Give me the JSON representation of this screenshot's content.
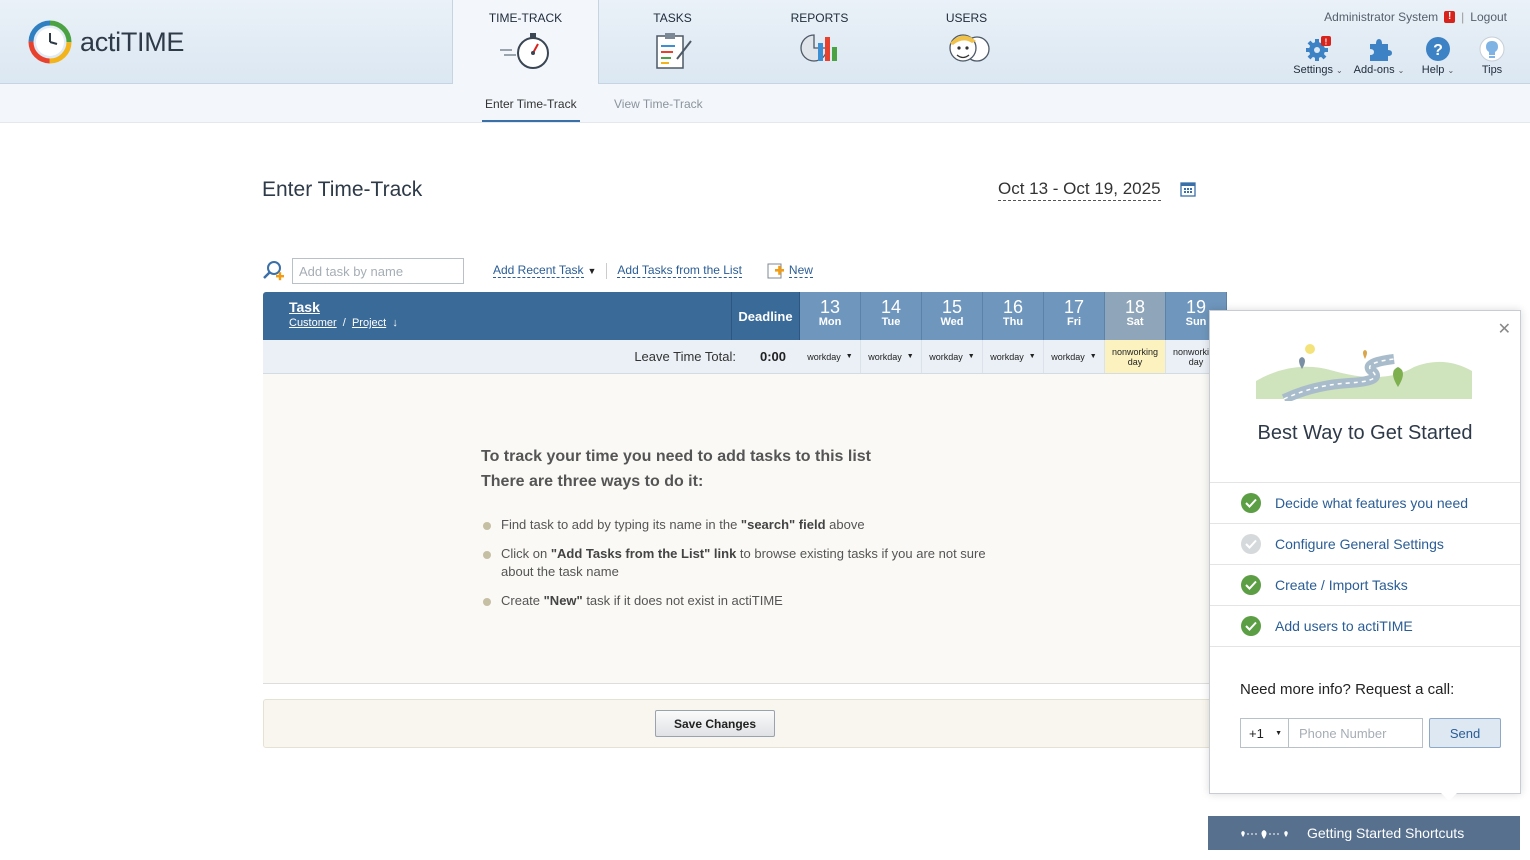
{
  "app": {
    "name": "actiTIME"
  },
  "nav": {
    "items": [
      {
        "label": "TIME-TRACK",
        "icon": "stopwatch-icon"
      },
      {
        "label": "TASKS",
        "icon": "clipboard-icon"
      },
      {
        "label": "REPORTS",
        "icon": "report-chart-icon"
      },
      {
        "label": "USERS",
        "icon": "users-icon"
      }
    ]
  },
  "user": {
    "name": "Administrator System",
    "logout": "Logout"
  },
  "tools": {
    "settings": "Settings",
    "addons": "Add-ons",
    "help": "Help",
    "tips": "Tips"
  },
  "subnav": {
    "enter": "Enter Time-Track",
    "view": "View Time-Track"
  },
  "page": {
    "title": "Enter Time-Track",
    "date_range": "Oct 13 - Oct 19, 2025"
  },
  "toolbar": {
    "search_placeholder": "Add task by name",
    "add_recent": "Add Recent Task",
    "add_from_list": "Add Tasks from the List",
    "new": "New"
  },
  "grid": {
    "task_header": "Task",
    "customer": "Customer",
    "project": "Project",
    "deadline": "Deadline",
    "leave_label": "Leave Time Total:",
    "leave_value": "0:00",
    "days": [
      {
        "num": "13",
        "name": "Mon",
        "type": "workday",
        "weekend": false
      },
      {
        "num": "14",
        "name": "Tue",
        "type": "workday",
        "weekend": false
      },
      {
        "num": "15",
        "name": "Wed",
        "type": "workday",
        "weekend": false
      },
      {
        "num": "16",
        "name": "Thu",
        "type": "workday",
        "weekend": false
      },
      {
        "num": "17",
        "name": "Fri",
        "type": "workday",
        "weekend": false
      },
      {
        "num": "18",
        "name": "Sat",
        "type": "nonworking day",
        "weekend": true
      },
      {
        "num": "19",
        "name": "Sun",
        "type": "nonworking day",
        "weekend": true
      }
    ]
  },
  "empty": {
    "line1": "To track your time you need to add tasks to this list",
    "line2": "There are three ways to do it:",
    "tips": [
      {
        "pre": "Find task to add by typing its name in the ",
        "bold": "\"search\" field",
        "post": " above"
      },
      {
        "pre": "Click on ",
        "bold": "\"Add Tasks from the List\" link",
        "post": " to browse existing tasks if you are not sure about the task name"
      },
      {
        "pre": "Create ",
        "bold": "\"New\"",
        "post": " task if it does not exist in actiTIME"
      }
    ]
  },
  "save_label": "Save Changes",
  "popup": {
    "title": "Best Way to Get Started",
    "steps": [
      {
        "label": "Decide what features you need",
        "done": true
      },
      {
        "label": "Configure General Settings",
        "done": false
      },
      {
        "label": "Create / Import Tasks",
        "done": true
      },
      {
        "label": "Add users to actiTIME",
        "done": true
      }
    ],
    "need_info": "Need more info? Request a call:",
    "code": "+1",
    "phone_placeholder": "Phone Number",
    "send": "Send"
  },
  "shortcuts_label": "Getting Started Shortcuts",
  "colors": {
    "header_blue": "#3a6a98",
    "day_blue": "#6f96bd",
    "weekend_yellow": "#fbf2bf",
    "check_green": "#5b9e43"
  }
}
